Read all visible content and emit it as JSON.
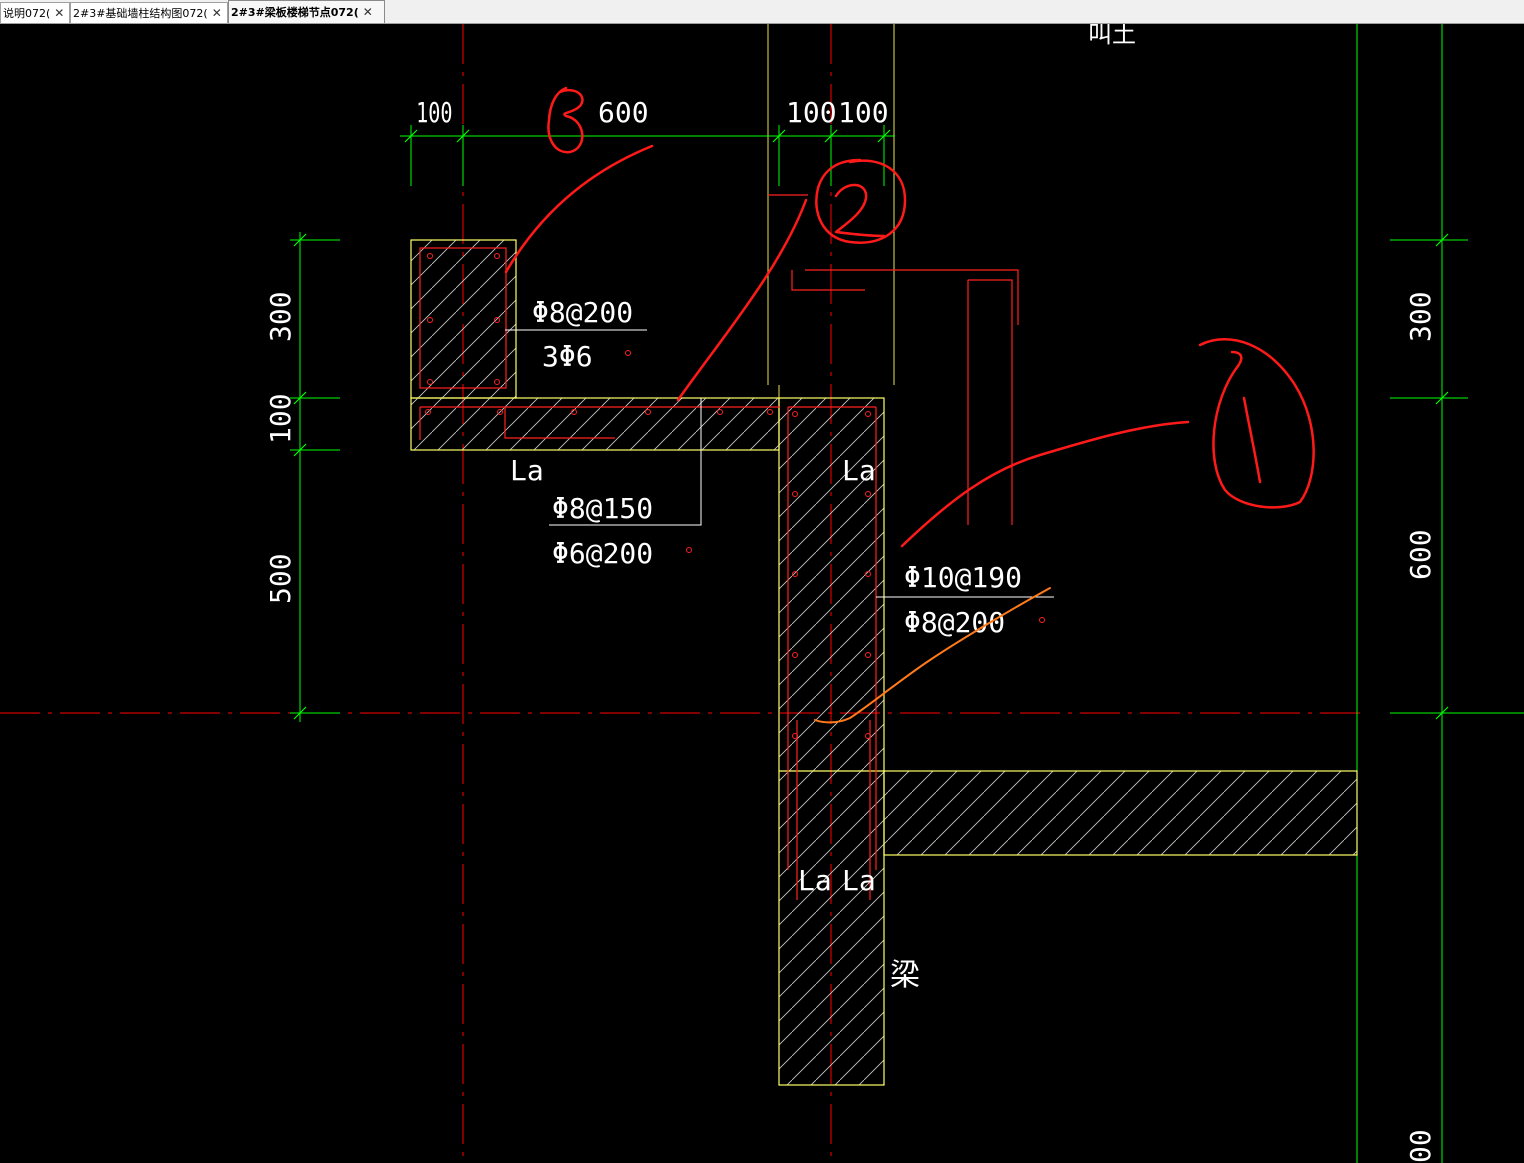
{
  "tabs": [
    {
      "label": "说明072(",
      "close": "✕"
    },
    {
      "label": "2#3#基础墙柱结构图072(",
      "close": "✕"
    },
    {
      "label": "2#3#梁板楼梯节点072(",
      "close": "✕",
      "active": true
    }
  ],
  "drawing": {
    "top_partial_label": "叫土",
    "dims_top": [
      "100",
      "600",
      "100",
      "100"
    ],
    "dims_left": [
      "300",
      "100",
      "500"
    ],
    "dims_right": [
      "300",
      "600",
      "00"
    ],
    "upper_beam_rebar": [
      "Φ8@200",
      "3Φ6"
    ],
    "slab_rebar": [
      "Φ8@150",
      "Φ6@200"
    ],
    "wall_rebar": [
      "Φ10@190",
      "Φ8@200"
    ],
    "anchor_labels": [
      "La",
      "La",
      "La",
      "La"
    ],
    "beam_label": "梁",
    "markup_numbers": [
      "③",
      "②",
      "①"
    ]
  },
  "colors": {
    "background": "#000000",
    "dimension": "#00ff00",
    "axis": "#ff0000",
    "outline": "#ffff66",
    "rebar": "#ff2020",
    "markup": "#ff1a1a",
    "markup_orange": "#ff7a1a",
    "text": "#ffffff"
  }
}
